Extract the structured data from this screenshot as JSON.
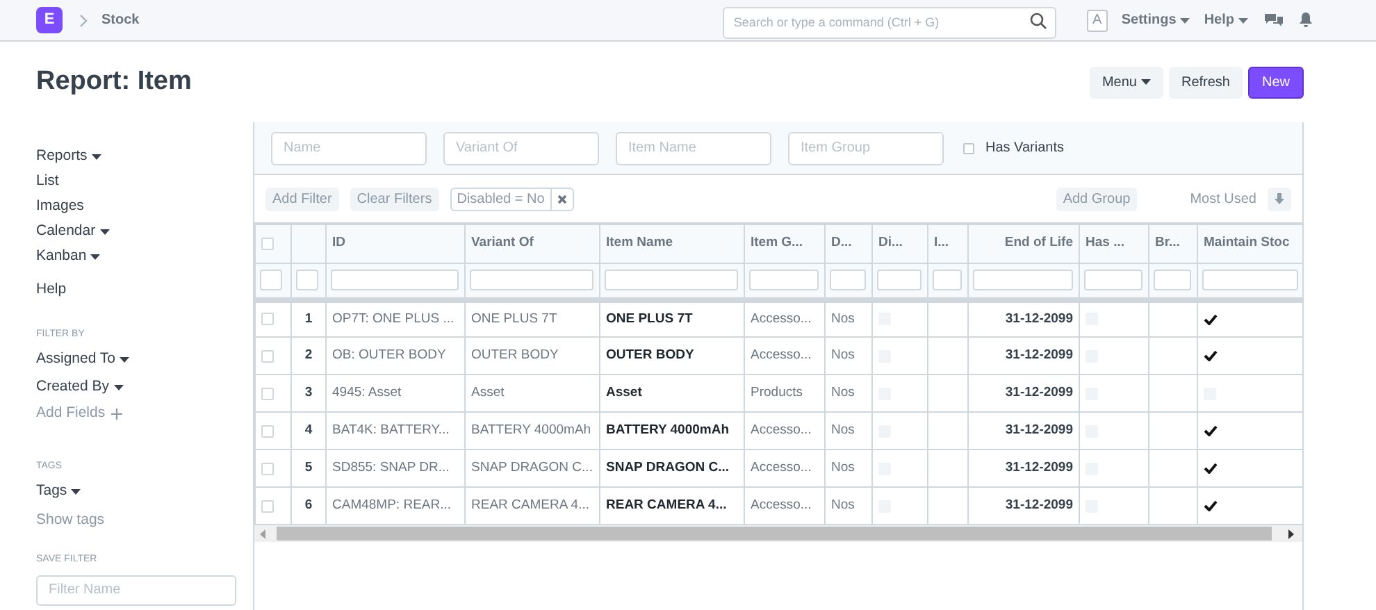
{
  "navbar": {
    "logo": "E",
    "breadcrumb": "Stock",
    "search": {
      "placeholder": "Search or type a command (Ctrl + G)"
    },
    "avatar": "A",
    "menus": [
      "Settings",
      "Help"
    ]
  },
  "page": {
    "title": "Report: Item",
    "buttons": [
      {
        "label": "Menu",
        "kind": "dropdown"
      },
      {
        "label": "Refresh",
        "kind": "plain"
      },
      {
        "label": "New",
        "kind": "primary"
      }
    ]
  },
  "sidebar": {
    "links": [
      {
        "label": "Reports",
        "dropdown": true
      },
      {
        "label": "List",
        "dropdown": false
      },
      {
        "label": "Images",
        "dropdown": false
      },
      {
        "label": "Calendar",
        "dropdown": true
      },
      {
        "label": "Kanban",
        "dropdown": true
      },
      {
        "label": "Help",
        "dropdown": false
      }
    ],
    "filter_by": {
      "heading": "FILTER BY",
      "items": [
        {
          "label": "Assigned To"
        },
        {
          "label": "Created By"
        }
      ],
      "add_fields": "Add Fields"
    },
    "tags": {
      "heading": "TAGS",
      "item": "Tags",
      "show_tags": "Show tags"
    },
    "save_filter": {
      "heading": "SAVE FILTER",
      "placeholder": "Filter Name"
    }
  },
  "standard_filters": {
    "fields": [
      {
        "placeholder": "Name"
      },
      {
        "placeholder": "Variant Of"
      },
      {
        "placeholder": "Item Name"
      },
      {
        "placeholder": "Item Group"
      }
    ],
    "checkbox": {
      "label": "Has Variants",
      "checked": false
    }
  },
  "filter_bar": {
    "add_filter": "Add Filter",
    "clear_filters": "Clear Filters",
    "active_filter": "Disabled = No",
    "add_group": "Add Group",
    "sort": "Most Used"
  },
  "table": {
    "all_selected": false,
    "columns": [
      {
        "label": "ID",
        "kind": "text"
      },
      {
        "label": "Variant Of",
        "kind": "text"
      },
      {
        "label": "Item Name",
        "kind": "bold"
      },
      {
        "label": "Item G...",
        "kind": "text"
      },
      {
        "label": "D...",
        "kind": "text"
      },
      {
        "label": "Di...",
        "kind": "check"
      },
      {
        "label": "I...",
        "kind": "text"
      },
      {
        "label": "End of Life",
        "kind": "date"
      },
      {
        "label": "Has ...",
        "kind": "check"
      },
      {
        "label": "Br...",
        "kind": "text"
      },
      {
        "label": "Maintain Stoc",
        "kind": "check"
      }
    ],
    "rows": [
      {
        "selected": false,
        "index": "1",
        "cells": [
          "OP7T: ONE PLUS ...",
          "ONE PLUS 7T",
          "ONE PLUS 7T",
          "Accesso...",
          "Nos",
          false,
          null,
          "31-12-2099",
          false,
          null,
          true
        ]
      },
      {
        "selected": false,
        "index": "2",
        "cells": [
          "OB: OUTER BODY",
          "OUTER BODY",
          "OUTER BODY",
          "Accesso...",
          "Nos",
          false,
          null,
          "31-12-2099",
          false,
          null,
          true
        ]
      },
      {
        "selected": false,
        "index": "3",
        "cells": [
          "4945: Asset",
          "Asset",
          "Asset",
          "Products",
          "Nos",
          false,
          null,
          "31-12-2099",
          false,
          null,
          false
        ]
      },
      {
        "selected": false,
        "index": "4",
        "cells": [
          "BAT4K: BATTERY...",
          "BATTERY 4000mAh",
          "BATTERY 4000mAh",
          "Accesso...",
          "Nos",
          false,
          null,
          "31-12-2099",
          false,
          null,
          true
        ]
      },
      {
        "selected": false,
        "index": "5",
        "cells": [
          "SD855: SNAP DR...",
          "SNAP DRAGON C...",
          "SNAP DRAGON C...",
          "Accesso...",
          "Nos",
          false,
          null,
          "31-12-2099",
          false,
          null,
          true
        ]
      },
      {
        "selected": false,
        "index": "6",
        "cells": [
          "CAM48MP: REAR...",
          "REAR CAMERA 4...",
          "REAR CAMERA 4...",
          "Accesso...",
          "Nos",
          false,
          null,
          "31-12-2099",
          false,
          null,
          true
        ]
      }
    ]
  }
}
